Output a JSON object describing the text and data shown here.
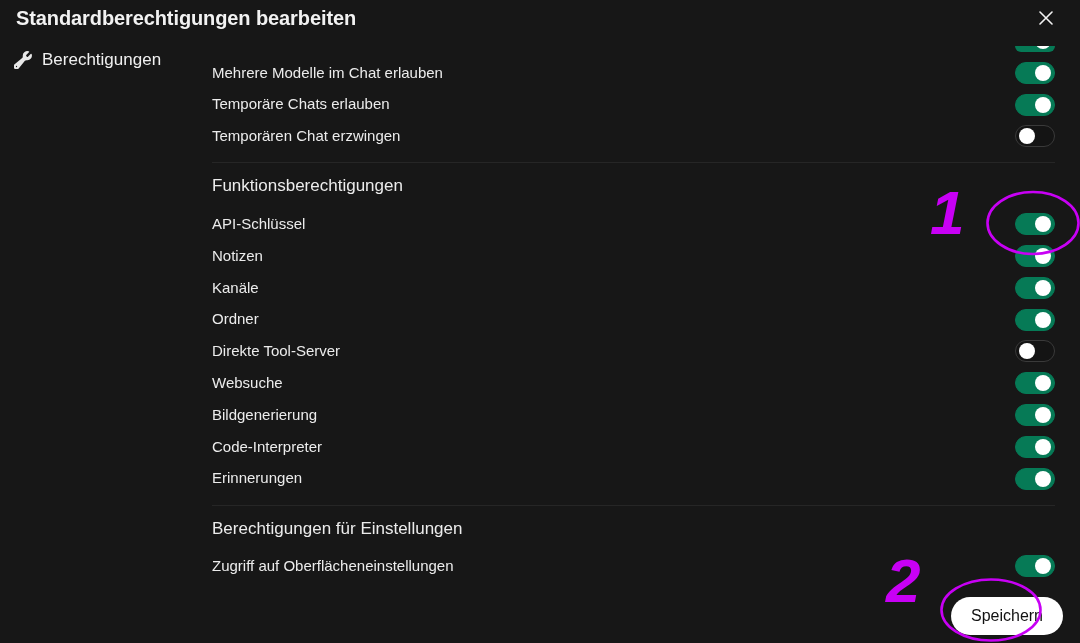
{
  "dialog": {
    "title": "Standardberechtigungen bearbeiten"
  },
  "sidebar": {
    "items": [
      {
        "label": "Berechtigungen"
      }
    ]
  },
  "sections": [
    {
      "cut_off_toggle": {
        "on": true
      },
      "rows": [
        {
          "label": "Mehrere Modelle im Chat erlauben",
          "on": true
        },
        {
          "label": "Temporäre Chats erlauben",
          "on": true
        },
        {
          "label": "Temporären Chat erzwingen",
          "on": false
        }
      ]
    },
    {
      "title": "Funktionsberechtigungen",
      "rows": [
        {
          "label": "API-Schlüssel",
          "on": true
        },
        {
          "label": "Notizen",
          "on": true
        },
        {
          "label": "Kanäle",
          "on": true
        },
        {
          "label": "Ordner",
          "on": true
        },
        {
          "label": "Direkte Tool-Server",
          "on": false
        },
        {
          "label": "Websuche",
          "on": true
        },
        {
          "label": "Bildgenerierung",
          "on": true
        },
        {
          "label": "Code-Interpreter",
          "on": true
        },
        {
          "label": "Erinnerungen",
          "on": true
        }
      ]
    },
    {
      "title": "Berechtigungen für Einstellungen",
      "rows": [
        {
          "label": "Zugriff auf Oberflächeneinstellungen",
          "on": true
        }
      ]
    }
  ],
  "save_button": {
    "label": "Speichern"
  },
  "annotations": [
    {
      "label": "1"
    },
    {
      "label": "2"
    }
  ]
}
